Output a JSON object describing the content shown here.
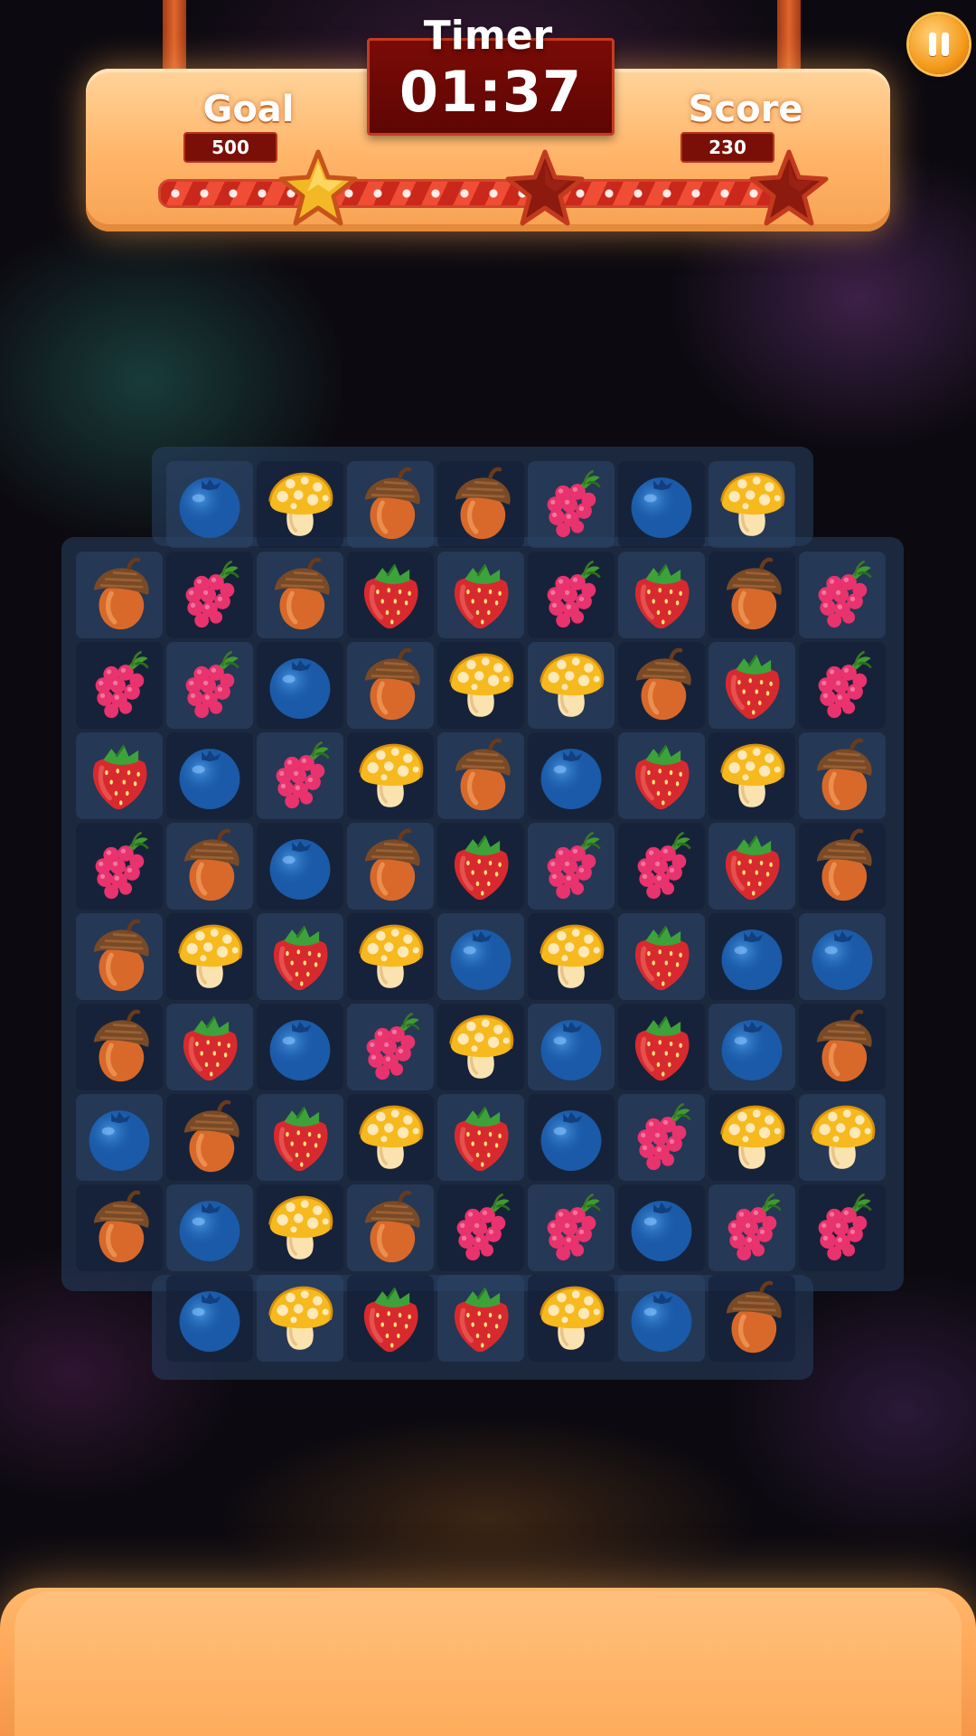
{
  "hud": {
    "timer_label": "Timer",
    "timer_value": "01:37",
    "goal_label": "Goal",
    "goal_value": "500",
    "score_label": "Score",
    "score_value": "230",
    "stars_earned": 1,
    "stars_total": 3,
    "colors": {
      "panel": "#ffb468",
      "timer_box": "#7a0b06",
      "star_earned": "#f3b825",
      "star_empty": "#8c1a0e"
    }
  },
  "board": {
    "cols": 9,
    "rows": 10,
    "items": [
      "acorn",
      "raspberry",
      "strawberry",
      "blueberry",
      "mushroom"
    ],
    "grid": [
      [
        null,
        "blueberry",
        "mushroom",
        "acorn",
        "acorn",
        "raspberry",
        "blueberry",
        "mushroom",
        null
      ],
      [
        "acorn",
        "raspberry",
        "acorn",
        "strawberry",
        "strawberry",
        "raspberry",
        "strawberry",
        "acorn",
        "raspberry"
      ],
      [
        "raspberry",
        "raspberry",
        "blueberry",
        "acorn",
        "mushroom",
        "mushroom",
        "acorn",
        "strawberry",
        "raspberry"
      ],
      [
        "strawberry",
        "blueberry",
        "raspberry",
        "mushroom",
        "acorn",
        "blueberry",
        "strawberry",
        "mushroom",
        "acorn"
      ],
      [
        "raspberry",
        "acorn",
        "blueberry",
        "acorn",
        "strawberry",
        "raspberry",
        "raspberry",
        "strawberry",
        "acorn"
      ],
      [
        "acorn",
        "mushroom",
        "strawberry",
        "mushroom",
        "blueberry",
        "mushroom",
        "strawberry",
        "blueberry",
        "blueberry"
      ],
      [
        "acorn",
        "strawberry",
        "blueberry",
        "raspberry",
        "mushroom",
        "blueberry",
        "strawberry",
        "blueberry",
        "acorn"
      ],
      [
        "blueberry",
        "acorn",
        "strawberry",
        "mushroom",
        "strawberry",
        "blueberry",
        "raspberry",
        "mushroom",
        "mushroom"
      ],
      [
        "acorn",
        "blueberry",
        "mushroom",
        "acorn",
        "raspberry",
        "raspberry",
        "blueberry",
        "raspberry",
        "raspberry"
      ],
      [
        null,
        "blueberry",
        "mushroom",
        "strawberry",
        "strawberry",
        "mushroom",
        "blueberry",
        "acorn",
        null
      ]
    ]
  }
}
